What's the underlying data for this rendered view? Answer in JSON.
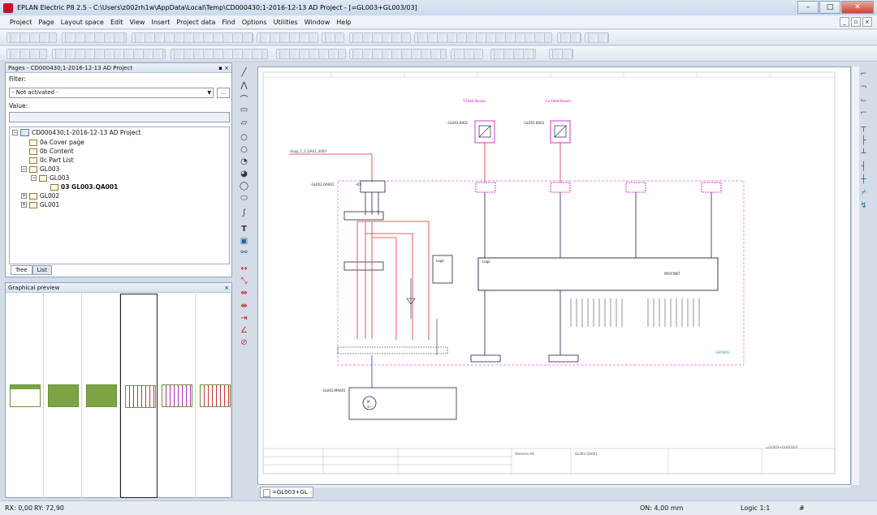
{
  "window": {
    "title": "EPLAN Electric P8 2.5 - C:\\Users\\z002rh1w\\AppData\\Local\\Temp\\CD000430;1-2016-12-13 AD Project - [=GL003+GL003/03]",
    "minimize": "–",
    "maximize": "□",
    "close": "✕"
  },
  "menu": [
    "Project",
    "Page",
    "Layout space",
    "Edit",
    "View",
    "Insert",
    "Project data",
    "Find",
    "Options",
    "Utilities",
    "Window",
    "Help"
  ],
  "pages_panel": {
    "header": "Pages - CD000430;1-2016-12-13 AD Project",
    "filter_label": "Filter:",
    "filter_value": "- Not activated -",
    "value_label": "Value:",
    "browse": "...",
    "tree": [
      {
        "label": "CD000430;1-2016-12-13 AD Project",
        "level": 0,
        "toggle": "−",
        "kind": "project"
      },
      {
        "label": "0a Cover page",
        "level": 1,
        "kind": "page"
      },
      {
        "label": "0b Content",
        "level": 1,
        "kind": "page"
      },
      {
        "label": "0c Part List",
        "level": 1,
        "kind": "page"
      },
      {
        "label": "GL003",
        "level": 1,
        "toggle": "−",
        "kind": "page"
      },
      {
        "label": "GL003",
        "level": 2,
        "toggle": "−",
        "kind": "page"
      },
      {
        "label": "03 GL003.QA001",
        "level": 3,
        "kind": "page",
        "bold": true
      },
      {
        "label": "GL002",
        "level": 1,
        "toggle": "+",
        "kind": "page"
      },
      {
        "label": "GL001",
        "level": 1,
        "toggle": "+",
        "kind": "page"
      }
    ],
    "tabs": [
      "Tree",
      "List"
    ]
  },
  "preview_panel": {
    "header": "Graphical preview",
    "close": "×"
  },
  "schematic": {
    "sensor1_title": "T-Feed Sensor",
    "sensor2_title": "Cu-Feed Sensor",
    "sensor1_ref": "-GL003.B001",
    "sensor2_ref": "-GL003.B002",
    "supply": "-Supp_1_3_QA01_400V",
    "breaker": "-GL003.QA001",
    "logic1": "Logic",
    "logic2": "Logic",
    "profinet": "PROFINET",
    "siemens": "SIEMENS",
    "motor_ref": "-GL003.MA001",
    "motor": "M",
    "motor_phase": "3~",
    "k1": "-K1",
    "titleblock": {
      "company": "Siemens AG",
      "doc": "GL003.QA001",
      "ref": "=GL003+GL003/03"
    }
  },
  "doc_tab": "=GL003+GL",
  "status": {
    "rx": "RX: 0,00",
    "ry": "RY: 72,90",
    "grid": "ON: 4,00 mm",
    "logic": "Logic 1:1",
    "hash": "#"
  }
}
